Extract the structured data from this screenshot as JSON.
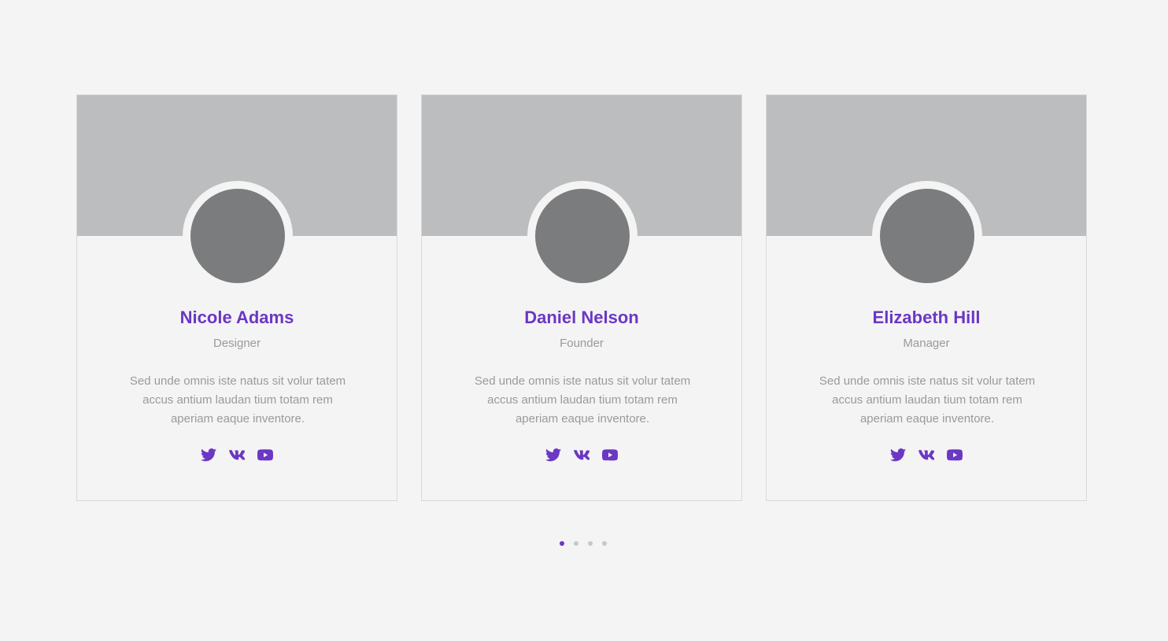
{
  "colors": {
    "background": "#f4f4f4",
    "cover": "#bcbdbe",
    "avatar": "#7b7c7d",
    "accent": "#6b37c4",
    "muted_text": "#9a9a9a",
    "dot_inactive": "#c8c8c8"
  },
  "cards": [
    {
      "name": "Nicole Adams",
      "role": "Designer",
      "description": "Sed unde omnis iste natus sit volur tatem accus antium laudan tium totam rem aperiam eaque inventore.",
      "social_icons": [
        "twitter-icon",
        "vk-icon",
        "youtube-icon"
      ]
    },
    {
      "name": "Daniel Nelson",
      "role": "Founder",
      "description": "Sed unde omnis iste natus sit volur tatem accus antium laudan tium totam rem aperiam eaque inventore.",
      "social_icons": [
        "twitter-icon",
        "vk-icon",
        "youtube-icon"
      ]
    },
    {
      "name": "Elizabeth Hill",
      "role": "Manager",
      "description": "Sed unde omnis iste natus sit volur tatem accus antium laudan tium totam rem aperiam eaque inventore.",
      "social_icons": [
        "twitter-icon",
        "vk-icon",
        "youtube-icon"
      ]
    }
  ],
  "pagination": {
    "total": 4,
    "active_index": 0
  }
}
